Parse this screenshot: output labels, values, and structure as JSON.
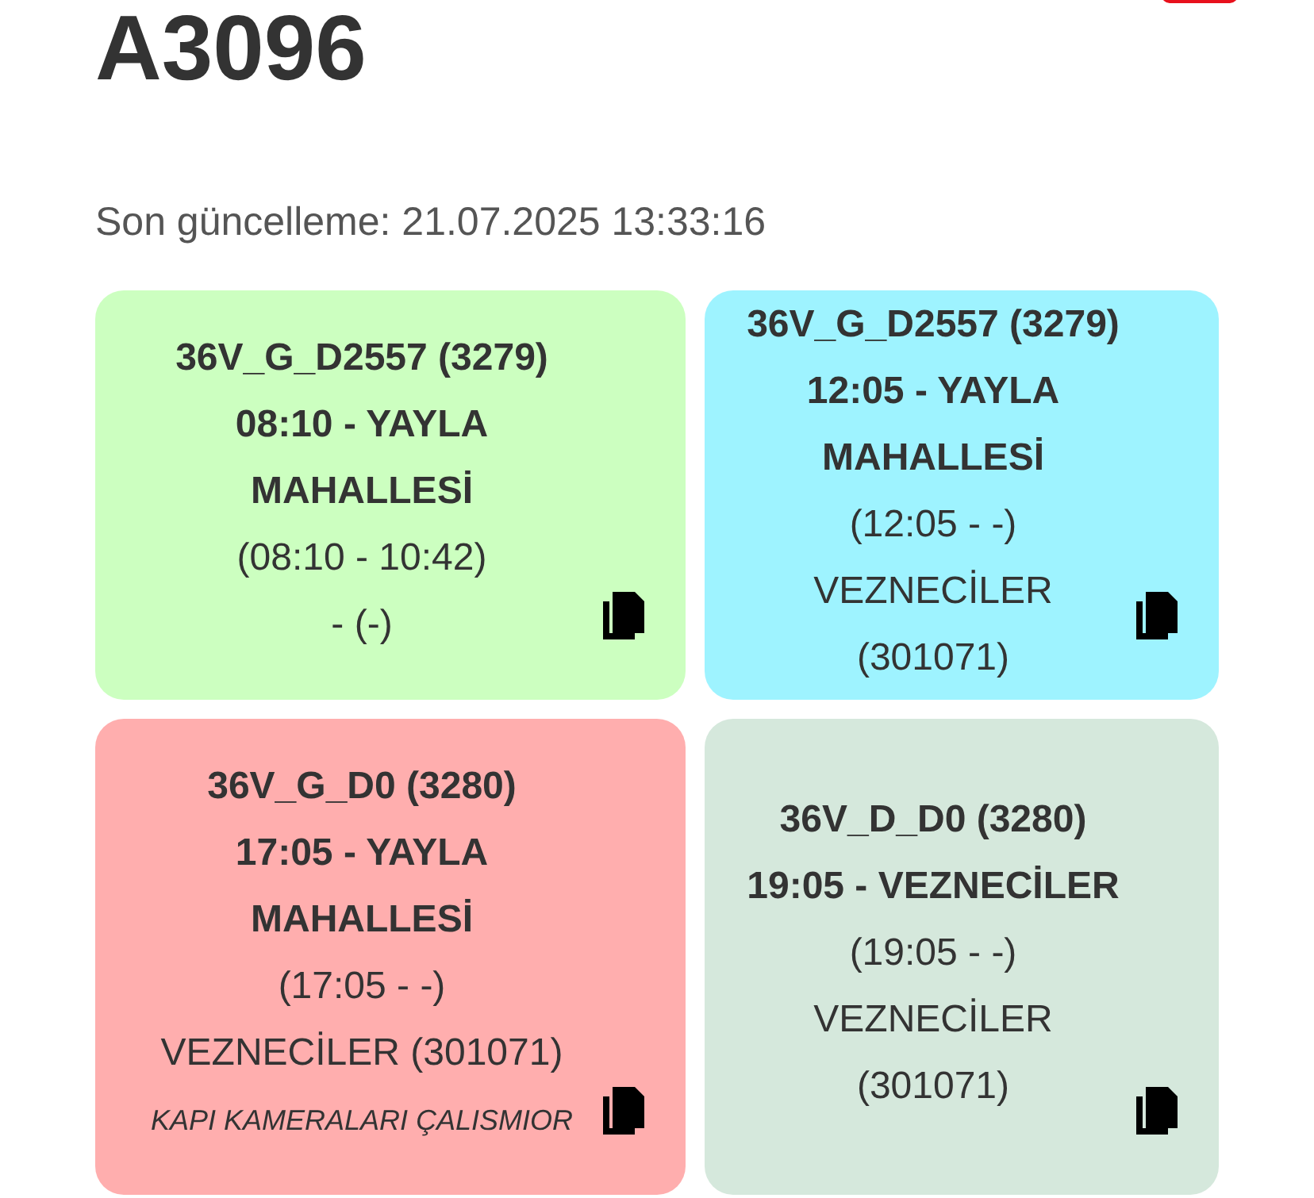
{
  "title": "A3096",
  "last_update": "Son güncelleme: 21.07.2025 13:33:16",
  "cards": [
    {
      "color": "#ccffc0",
      "lines": [
        {
          "kind": "bold",
          "text": "36V_G_D2557 (3279)"
        },
        {
          "kind": "bold",
          "text": "08:10 - YAYLA MAHALLESİ"
        },
        {
          "kind": "normal",
          "text": "(08:10 - 10:42)"
        },
        {
          "kind": "normal",
          "text": "- (-)"
        }
      ]
    },
    {
      "color": "#9ef3ff",
      "lines": [
        {
          "kind": "bold",
          "text": "36V_G_D2557 (3279)"
        },
        {
          "kind": "bold",
          "text": "12:05 - YAYLA MAHALLESİ"
        },
        {
          "kind": "normal",
          "text": "(12:05 - -)"
        },
        {
          "kind": "normal",
          "text": "VEZNECİLER (301071)"
        }
      ]
    },
    {
      "color": "#ffaeae",
      "lines": [
        {
          "kind": "bold",
          "text": "36V_G_D0 (3280)"
        },
        {
          "kind": "bold",
          "text": "17:05 - YAYLA MAHALLESİ"
        },
        {
          "kind": "normal",
          "text": "(17:05 - -)"
        },
        {
          "kind": "normal",
          "text": "VEZNECİLER (301071)"
        },
        {
          "kind": "italic",
          "text": "KAPI KAMERALARI ÇALISMIOR"
        }
      ]
    },
    {
      "color": "#d5e8dc",
      "lines": [
        {
          "kind": "bold",
          "text": "36V_D_D0 (3280)"
        },
        {
          "kind": "bold",
          "text": "19:05 - VEZNECİLER"
        },
        {
          "kind": "normal",
          "text": "(19:05 - -)"
        },
        {
          "kind": "normal",
          "text": "VEZNECİLER (301071)"
        }
      ]
    }
  ]
}
